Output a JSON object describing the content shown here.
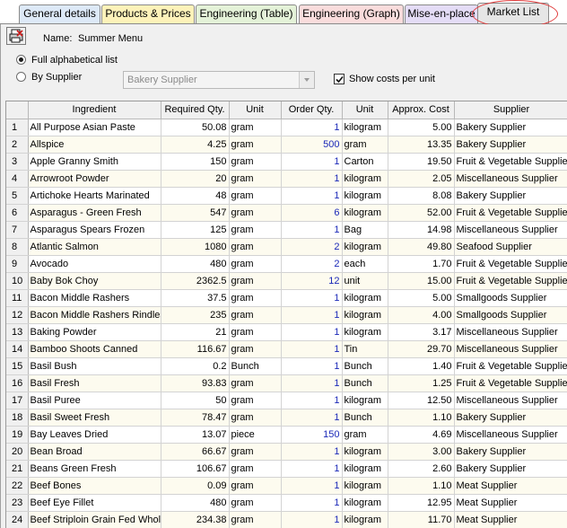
{
  "tabs": [
    {
      "label": "General details",
      "bg": "#dde9f7"
    },
    {
      "label": "Products & Prices",
      "bg": "#fdf2b9"
    },
    {
      "label": "Engineering (Table)",
      "bg": "#e4f2d8"
    },
    {
      "label": "Engineering (Graph)",
      "bg": "#f9dcdc"
    },
    {
      "label": "Mise-en-place",
      "bg": "#e4dcf6"
    },
    {
      "label": "Market List",
      "bg": "#e6e6e6"
    }
  ],
  "form": {
    "name_label": "Name:",
    "name_value": "Summer Menu",
    "radio_full": "Full alphabetical list",
    "radio_supplier": "By Supplier",
    "supplier_selected": "Bakery Supplier",
    "show_costs_label": "Show costs per unit",
    "show_costs_checked": true
  },
  "grid": {
    "headers": [
      "",
      "Ingredient",
      "Required Qty.",
      "Unit",
      "Order Qty.",
      "Unit",
      "Approx. Cost",
      "Supplier"
    ],
    "rows": [
      [
        "1",
        "All Purpose Asian Paste",
        "50.08",
        "gram",
        "1",
        "kilogram",
        "5.00",
        "Bakery Supplier"
      ],
      [
        "2",
        "Allspice",
        "4.25",
        "gram",
        "500",
        "gram",
        "13.35",
        "Bakery Supplier"
      ],
      [
        "3",
        "Apple Granny Smith",
        "150",
        "gram",
        "1",
        "Carton",
        "19.50",
        "Fruit & Vegetable Supplier"
      ],
      [
        "4",
        "Arrowroot Powder",
        "20",
        "gram",
        "1",
        "kilogram",
        "2.05",
        "Miscellaneous Supplier"
      ],
      [
        "5",
        "Artichoke Hearts Marinated",
        "48",
        "gram",
        "1",
        "kilogram",
        "8.08",
        "Bakery Supplier"
      ],
      [
        "6",
        "Asparagus - Green Fresh",
        "547",
        "gram",
        "6",
        "kilogram",
        "52.00",
        "Fruit & Vegetable Supplier"
      ],
      [
        "7",
        "Asparagus Spears Frozen",
        "125",
        "gram",
        "1",
        "Bag",
        "14.98",
        "Miscellaneous Supplier"
      ],
      [
        "8",
        "Atlantic Salmon",
        "1080",
        "gram",
        "2",
        "kilogram",
        "49.80",
        "Seafood Supplier"
      ],
      [
        "9",
        "Avocado",
        "480",
        "gram",
        "2",
        "each",
        "1.70",
        "Fruit & Vegetable Supplier"
      ],
      [
        "10",
        "Baby Bok Choy",
        "2362.5",
        "gram",
        "12",
        "unit",
        "15.00",
        "Fruit & Vegetable Supplier"
      ],
      [
        "11",
        "Bacon Middle Rashers",
        "37.5",
        "gram",
        "1",
        "kilogram",
        "5.00",
        "Smallgoods Supplier"
      ],
      [
        "12",
        "Bacon Middle Rashers Rindless",
        "235",
        "gram",
        "1",
        "kilogram",
        "4.00",
        "Smallgoods Supplier"
      ],
      [
        "13",
        "Baking Powder",
        "21",
        "gram",
        "1",
        "kilogram",
        "3.17",
        "Miscellaneous Supplier"
      ],
      [
        "14",
        "Bamboo Shoots Canned",
        "116.67",
        "gram",
        "1",
        "Tin",
        "29.70",
        "Miscellaneous Supplier"
      ],
      [
        "15",
        "Basil Bush",
        "0.2",
        "Bunch",
        "1",
        "Bunch",
        "1.40",
        "Fruit & Vegetable Supplier"
      ],
      [
        "16",
        "Basil Fresh",
        "93.83",
        "gram",
        "1",
        "Bunch",
        "1.25",
        "Fruit & Vegetable Supplier"
      ],
      [
        "17",
        "Basil Puree",
        "50",
        "gram",
        "1",
        "kilogram",
        "12.50",
        "Miscellaneous Supplier"
      ],
      [
        "18",
        "Basil Sweet Fresh",
        "78.47",
        "gram",
        "1",
        "Bunch",
        "1.10",
        "Bakery Supplier"
      ],
      [
        "19",
        "Bay Leaves Dried",
        "13.07",
        "piece",
        "150",
        "gram",
        "4.69",
        "Miscellaneous Supplier"
      ],
      [
        "20",
        "Bean Broad",
        "66.67",
        "gram",
        "1",
        "kilogram",
        "3.00",
        "Bakery Supplier"
      ],
      [
        "21",
        "Beans Green Fresh",
        "106.67",
        "gram",
        "1",
        "kilogram",
        "2.60",
        "Bakery Supplier"
      ],
      [
        "22",
        "Beef Bones",
        "0.09",
        "gram",
        "1",
        "kilogram",
        "1.10",
        "Meat Supplier"
      ],
      [
        "23",
        "Beef Eye Fillet",
        "480",
        "gram",
        "1",
        "kilogram",
        "12.95",
        "Meat Supplier"
      ],
      [
        "24",
        "Beef Striploin Grain Fed Whole",
        "234.38",
        "gram",
        "1",
        "kilogram",
        "11.70",
        "Meat Supplier"
      ]
    ]
  },
  "colors": {
    "order_qty_text": "#1a28b8",
    "active_tab_highlight": "#e03a3a",
    "alt_row": "#fdfbef"
  }
}
